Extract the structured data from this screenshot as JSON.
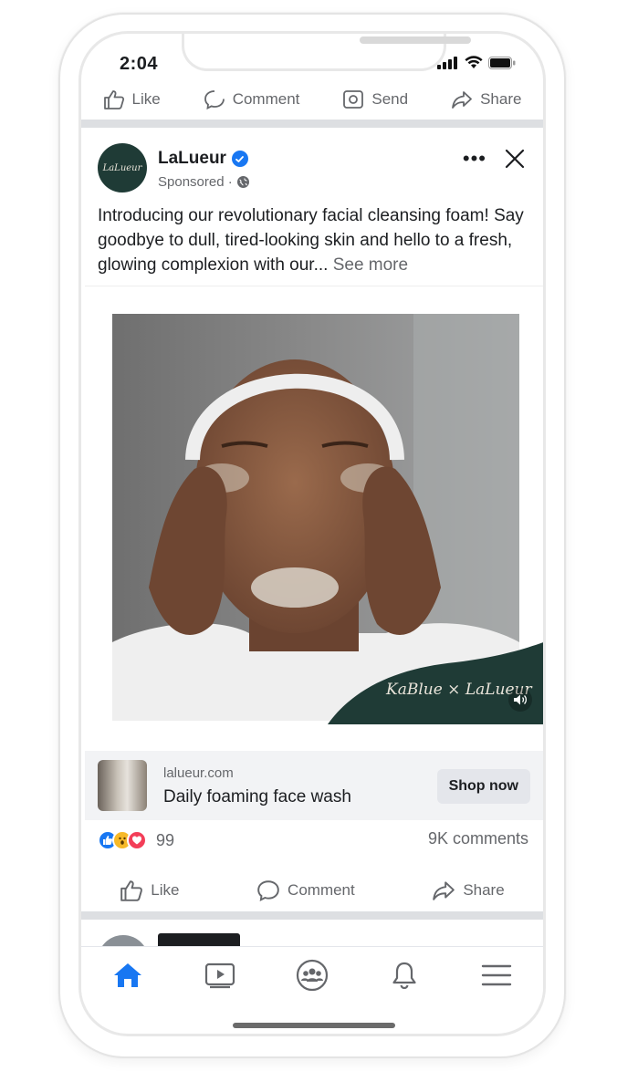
{
  "status_bar": {
    "time": "2:04"
  },
  "previous_post_actions": {
    "like": "Like",
    "comment": "Comment",
    "send": "Send",
    "share": "Share"
  },
  "post": {
    "page_name": "LaLueur",
    "avatar_text": "LaLueur",
    "sponsored_label": "Sponsored ·",
    "caption": "Introducing our revolutionary facial cleansing foam! Say goodbye to dull, tired-looking skin and hello to a fresh, glowing complexion with our...",
    "see_more": "See more",
    "video_overlay_brand": "KaBlue × LaLueur",
    "link": {
      "domain": "lalueur.com",
      "title": "Daily foaming face wash",
      "cta": "Shop now"
    },
    "reaction_count": "99",
    "comments_count": "9K comments",
    "actions": {
      "like": "Like",
      "comment": "Comment",
      "share": "Share"
    }
  },
  "bottom_nav": [
    "home-icon",
    "video-icon",
    "groups-icon",
    "bell-icon",
    "menu-icon"
  ],
  "colors": {
    "accent": "#1877f2",
    "brand_green": "#1f3b36",
    "text_secondary": "#65676b",
    "divider": "#dddfe2"
  }
}
